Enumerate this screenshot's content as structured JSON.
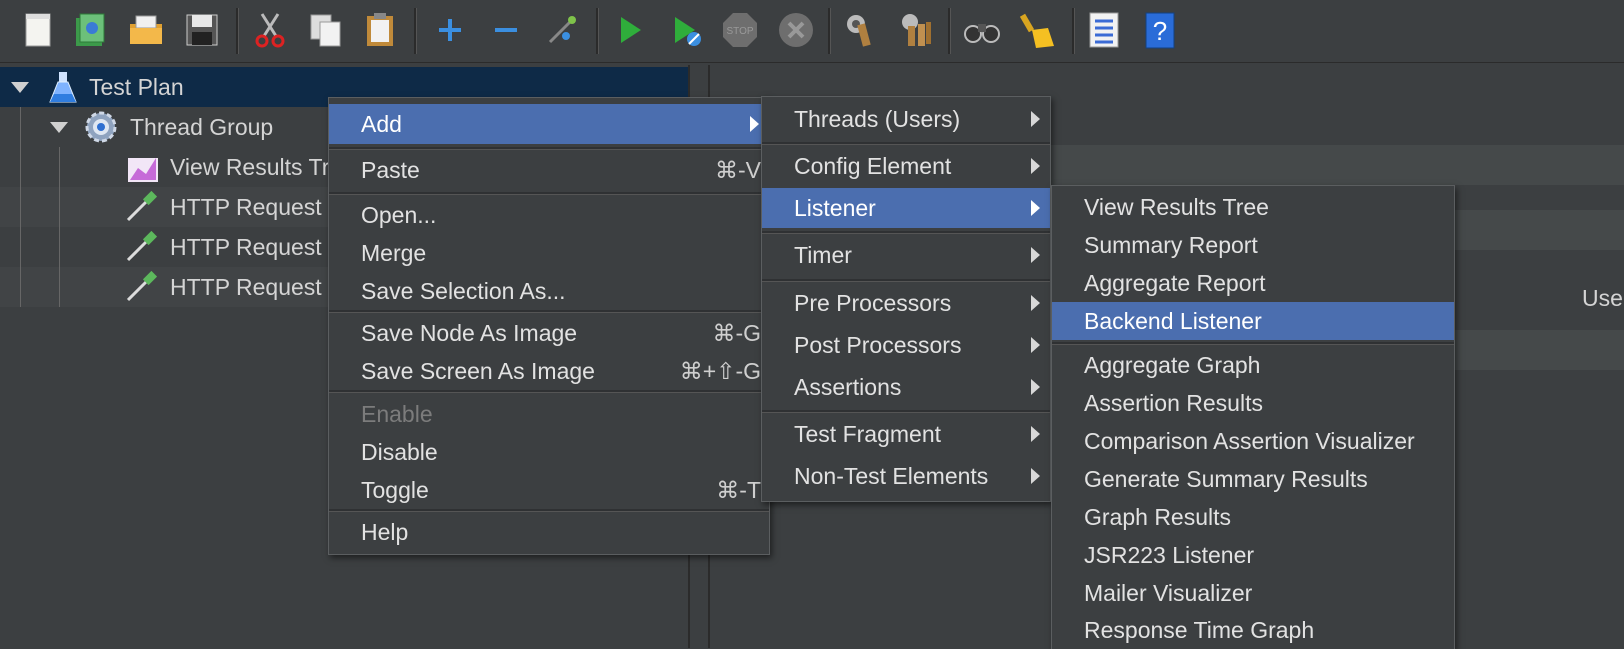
{
  "toolbar": {
    "icons": [
      "new-icon",
      "templates-icon",
      "open-icon",
      "save-icon",
      "cut-icon",
      "copy-icon",
      "paste-icon",
      "expand-icon",
      "collapse-icon",
      "toggle-icon",
      "start-icon",
      "start-no-pause-icon",
      "stop-icon",
      "shutdown-icon",
      "clear-icon",
      "clear-all-icon",
      "search-icon",
      "reset-search-icon",
      "function-helper-icon",
      "help-icon"
    ],
    "stop_text": "STOP"
  },
  "tree": {
    "test_plan": "Test Plan",
    "thread_group": "Thread Group",
    "items": [
      "View Results Tr",
      "HTTP Request",
      "HTTP Request",
      "HTTP Request"
    ]
  },
  "right_panel": {
    "partial_label": "Use"
  },
  "context_menu": {
    "items": [
      {
        "label": "Add",
        "shortcut": ""
      },
      {
        "label": "Paste",
        "shortcut": "⌘-V"
      },
      {
        "label": "Open...",
        "shortcut": ""
      },
      {
        "label": "Merge",
        "shortcut": ""
      },
      {
        "label": "Save Selection As...",
        "shortcut": ""
      },
      {
        "label": "Save Node As Image",
        "shortcut": "⌘-G"
      },
      {
        "label": "Save Screen As Image",
        "shortcut": "⌘+⇧-G"
      },
      {
        "label": "Enable",
        "shortcut": ""
      },
      {
        "label": "Disable",
        "shortcut": ""
      },
      {
        "label": "Toggle",
        "shortcut": "⌘-T"
      },
      {
        "label": "Help",
        "shortcut": ""
      }
    ]
  },
  "add_submenu": {
    "items": [
      "Threads (Users)",
      "Config Element",
      "Listener",
      "Timer",
      "Pre Processors",
      "Post Processors",
      "Assertions",
      "Test Fragment",
      "Non-Test Elements"
    ]
  },
  "listener_submenu": {
    "items": [
      "View Results Tree",
      "Summary Report",
      "Aggregate Report",
      "Backend Listener",
      "Aggregate Graph",
      "Assertion Results",
      "Comparison Assertion Visualizer",
      "Generate Summary Results",
      "Graph Results",
      "JSR223 Listener",
      "Mailer Visualizer",
      "Response Time Graph"
    ]
  },
  "colors": {
    "highlight": "#4b6eaf",
    "background": "#3c3f41",
    "tree_selected": "#0e2a47"
  }
}
